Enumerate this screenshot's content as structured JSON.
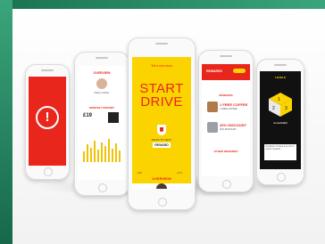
{
  "colors": {
    "brand_red": "#e8261b",
    "brand_yellow": "#fbd400",
    "background_green": "#1f7a56"
  },
  "phone1": {
    "icon": "alert-icon",
    "icon_glyph": "!"
  },
  "phone2": {
    "header": "OVERVIEW",
    "name": "Daisy Twitter",
    "subtitle": "MONTHLY REPORT",
    "amount": "£19"
  },
  "phone3": {
    "tagline": "Tell a new story",
    "title_line1": "START",
    "title_line2": "DRIVE",
    "reward_label": "MILES TO NEXT",
    "reward": "REWARD",
    "stat_left": "£28",
    "stat_right": "27%",
    "section": "OVERVIEW"
  },
  "phone4": {
    "brand": "REWARDS",
    "section": "REWARDS",
    "offer1": "1 FREE COFFEE",
    "offer1_sub": "1 FREE COFFEE",
    "offer2": "20% DISCOUNT",
    "offer2_sub": "20% DISCOUNT",
    "section2": "OTHER REWARDS"
  },
  "phone5": {
    "header": "LEVELS",
    "cube_numbers": [
      "1",
      "2",
      "3"
    ],
    "level_label": "ALLEADER",
    "info_text": "Complete 3 drives in a row to unlock rewards"
  }
}
